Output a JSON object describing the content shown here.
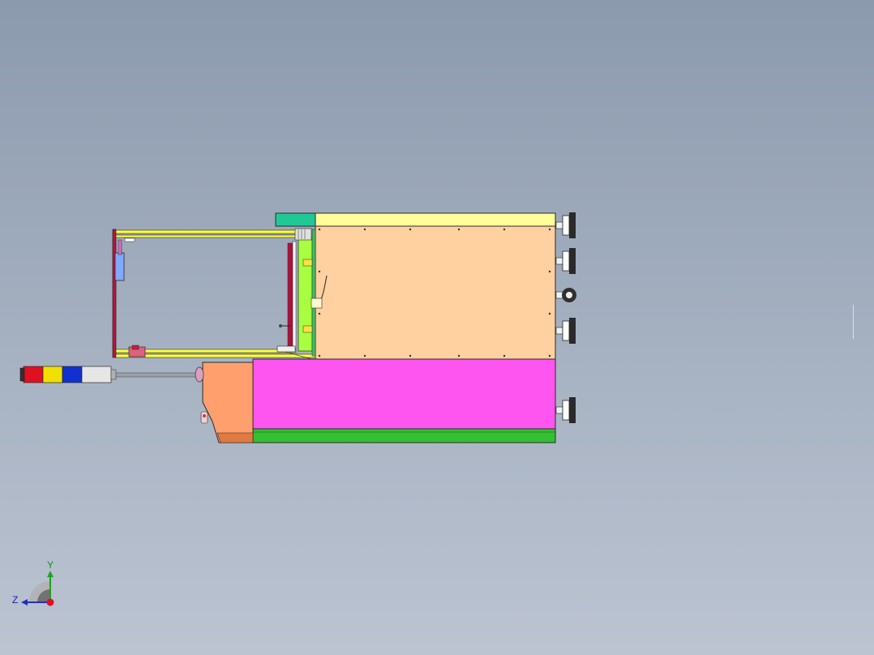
{
  "viewport": {
    "background_top": "#8c9aae",
    "background_bottom": "#bcc4d2"
  },
  "model": {
    "colors": {
      "cabinet_upper": "#ffd0a0",
      "cabinet_top_strip": "#ffff99",
      "cabinet_top_block": "#20c896",
      "cabinet_lower": "#ff55f0",
      "base_rail": "#33c033",
      "side_panel": "#ff9f6e",
      "frame_rail": "#ffff40",
      "frame_edge": "#c0103a",
      "bracket": "#7fa8ff",
      "inner_plate": "#a8ff40",
      "caster": "#303030"
    },
    "signal_tower": {
      "segments": [
        {
          "name": "red",
          "color": "#e01020"
        },
        {
          "name": "yellow",
          "color": "#f0e000"
        },
        {
          "name": "blue",
          "color": "#1030d0"
        },
        {
          "name": "white",
          "color": "#e6e6e6"
        }
      ],
      "pole_color": "#9aa0a8"
    }
  },
  "triad": {
    "y_label": "Y",
    "z_label": "Z",
    "x_axis_color": "#e01020",
    "y_axis_color": "#20a020",
    "z_axis_color": "#2030c0"
  }
}
